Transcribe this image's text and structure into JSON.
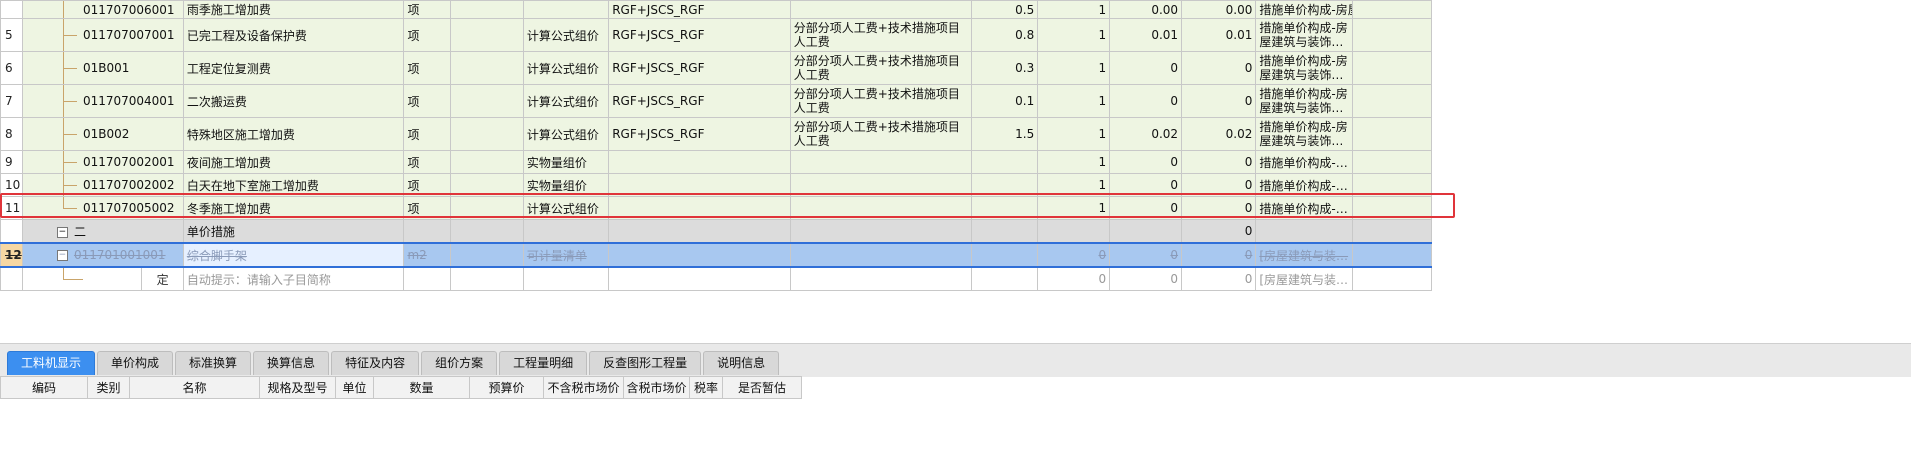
{
  "rows": [
    {
      "num": "",
      "code": "011707006001",
      "name": "雨季施工增加费",
      "unit": "项",
      "method": "",
      "base": "RGF+JSCS_RGF",
      "desc": "",
      "rate": "0.5",
      "qty": "1",
      "price": "0.00",
      "total": "0.00",
      "construct": "措施单价构成-房屋建筑与装饰…"
    },
    {
      "num": "5",
      "code": "011707007001",
      "name": "已完工程及设备保护费",
      "unit": "项",
      "method": "计算公式组价",
      "base": "RGF+JSCS_RGF",
      "desc": "分部分项人工费+技术措施项目人工费",
      "rate": "0.8",
      "qty": "1",
      "price": "0.01",
      "total": "0.01",
      "construct": "措施单价构成-房屋建筑与装饰…"
    },
    {
      "num": "6",
      "code": "01B001",
      "name": "工程定位复测费",
      "unit": "项",
      "method": "计算公式组价",
      "base": "RGF+JSCS_RGF",
      "desc": "分部分项人工费+技术措施项目人工费",
      "rate": "0.3",
      "qty": "1",
      "price": "0",
      "total": "0",
      "construct": "措施单价构成-房屋建筑与装饰…"
    },
    {
      "num": "7",
      "code": "011707004001",
      "name": "二次搬运费",
      "unit": "项",
      "method": "计算公式组价",
      "base": "RGF+JSCS_RGF",
      "desc": "分部分项人工费+技术措施项目人工费",
      "rate": "0.1",
      "qty": "1",
      "price": "0",
      "total": "0",
      "construct": "措施单价构成-房屋建筑与装饰…"
    },
    {
      "num": "8",
      "code": "01B002",
      "name": "特殊地区施工增加费",
      "unit": "项",
      "method": "计算公式组价",
      "base": "RGF+JSCS_RGF",
      "desc": "分部分项人工费+技术措施项目人工费",
      "rate": "1.5",
      "qty": "1",
      "price": "0.02",
      "total": "0.02",
      "construct": "措施单价构成-房屋建筑与装饰…"
    },
    {
      "num": "9",
      "code": "011707002001",
      "name": "夜间施工增加费",
      "unit": "项",
      "method": "实物量组价",
      "base": "",
      "desc": "",
      "rate": "",
      "qty": "1",
      "price": "0",
      "total": "0",
      "construct": "措施单价构成-…"
    },
    {
      "num": "10",
      "code": "011707002002",
      "name": "白天在地下室施工增加费",
      "unit": "项",
      "method": "实物量组价",
      "base": "",
      "desc": "",
      "rate": "",
      "qty": "1",
      "price": "0",
      "total": "0",
      "construct": "措施单价构成-…"
    },
    {
      "num": "11",
      "code": "011707005002",
      "name": "冬季施工增加费",
      "unit": "项",
      "method": "计算公式组价",
      "base": "",
      "desc": "",
      "rate": "",
      "qty": "1",
      "price": "0",
      "total": "0",
      "construct": "措施单价构成-…"
    }
  ],
  "section_row": {
    "toggle": "−",
    "code": "二",
    "name": "单价措施",
    "total": "0"
  },
  "selected_row": {
    "num": "12",
    "toggle": "−",
    "code": "011701001001",
    "name": "综合脚手架",
    "unit": "m2",
    "method": "可计量清单",
    "qty": "0",
    "price": "0",
    "total": "0",
    "construct": "[房屋建筑与装…"
  },
  "sub_row": {
    "type": "定",
    "name": "自动提示：请输入子目简称",
    "qty": "0",
    "price": "0",
    "total": "0",
    "construct": "[房屋建筑与装…"
  },
  "tabs": [
    "工料机显示",
    "单价构成",
    "标准换算",
    "换算信息",
    "特征及内容",
    "组价方案",
    "工程量明细",
    "反查图形工程量",
    "说明信息"
  ],
  "sub_headers": [
    "编码",
    "类别",
    "名称",
    "规格及型号",
    "单位",
    "数量",
    "预算价",
    "不含税市场价",
    "含税市场价",
    "税率",
    "是否暂估"
  ],
  "colors": {
    "accent": "#3c8ff0",
    "highlight_border": "#e0343a",
    "selection": "#a8c8f0",
    "row_green": "#eef5e2"
  }
}
